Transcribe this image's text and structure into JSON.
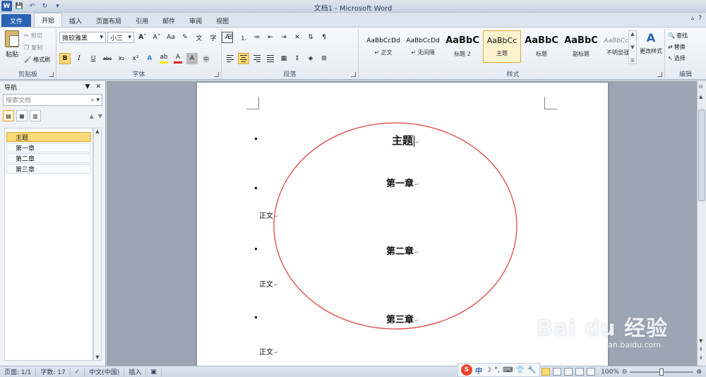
{
  "window": {
    "title": "文档1 - Microsoft Word"
  },
  "qat": {
    "logo": "W",
    "save": "💾",
    "undo": "↶",
    "redo": "↻",
    "more": "▾"
  },
  "tabs": [
    "文件",
    "开始",
    "插入",
    "页面布局",
    "引用",
    "邮件",
    "审阅",
    "视图"
  ],
  "active_tab": "开始",
  "tabbar_right": {
    "min": "▵",
    "help": "?"
  },
  "ribbon": {
    "clipboard": {
      "label": "剪贴板",
      "paste": "粘贴",
      "cut": "剪切",
      "copy": "复制",
      "format_painter": "格式刷"
    },
    "font": {
      "label": "字体",
      "name": "微软雅黑",
      "size": "小三",
      "grow": "A",
      "shrink": "A",
      "case": "Aa",
      "clear": "A",
      "bold": "B",
      "italic": "I",
      "underline": "U",
      "strike": "abc",
      "sub": "x₂",
      "sup": "x²"
    },
    "paragraph": {
      "label": "段落"
    },
    "styles": {
      "label": "样式",
      "items": [
        {
          "sample": "AaBbCcDd",
          "name": "↵ 正文"
        },
        {
          "sample": "AaBbCcDd",
          "name": "↵ 无间隔"
        },
        {
          "sample": "AaBbC",
          "name": "标题 2"
        },
        {
          "sample": "AaBbCc",
          "name": "主题"
        },
        {
          "sample": "AaBbC",
          "name": "标题"
        },
        {
          "sample": "AaBbC",
          "name": "副标题"
        },
        {
          "sample": "AaBbCcDd",
          "name": "不明显强调"
        }
      ],
      "selected_index": 3,
      "change_styles": "更改样式"
    },
    "editing": {
      "label": "编辑",
      "find": "查找",
      "replace": "替换",
      "select": "选择"
    }
  },
  "nav": {
    "title": "导航",
    "search_placeholder": "搜索文档",
    "items": [
      "主题",
      "第一章",
      "第二章",
      "第三章"
    ],
    "active_index": 0
  },
  "document": {
    "title": "主题",
    "chapter1": "第一章",
    "body1": "正文",
    "chapter2": "第二章",
    "body2": "正文",
    "chapter3": "第三章",
    "body3": "正文",
    "para_mark": "↵"
  },
  "annotation": {
    "circle_color": "#e03a3a"
  },
  "status": {
    "page": "页面: 1/1",
    "words": "字数: 17",
    "language": "中文(中国)",
    "mode": "插入",
    "zoom": "100%"
  },
  "ime": {
    "logo": "S",
    "mode": "中"
  },
  "watermark": {
    "main": "Bai du 经验",
    "sub": "jingyan.baidu.com"
  }
}
